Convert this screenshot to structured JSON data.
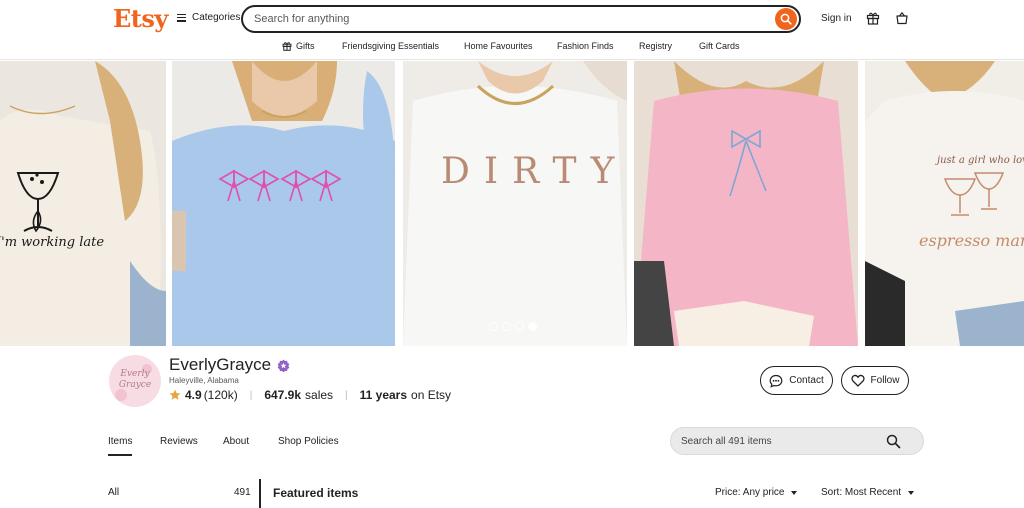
{
  "header": {
    "logo": "Etsy",
    "categories_label": "Categories",
    "search_placeholder": "Search for anything",
    "signin_label": "Sign in"
  },
  "nav": {
    "items": [
      "Gifts",
      "Friendsgiving Essentials",
      "Home Favourites",
      "Fashion Finds",
      "Registry",
      "Gift Cards"
    ]
  },
  "banner": {
    "panels": [
      {
        "text": "I'm working late",
        "shirt_color": "#f2ebe2"
      },
      {
        "text": "",
        "shirt_color": "#a9c8ea"
      },
      {
        "text": "DIRTY",
        "shirt_color": "#f7f7f5"
      },
      {
        "text": "",
        "shirt_color": "#f4b6c6"
      },
      {
        "text": "just a girl who loves",
        "text2": "espresso marti",
        "shirt_color": "#f6f3ef"
      }
    ],
    "slide_count": 4,
    "active_slide": 4
  },
  "shop": {
    "name": "EverlyGrayce",
    "avatar_text": "Everly Grayce",
    "location": "Haleyville, Alabama",
    "rating": "4.9",
    "review_count": "(120k)",
    "sales_value": "647.9k",
    "sales_label": "sales",
    "years_value": "11 years",
    "years_label": "on Etsy",
    "contact_label": "Contact",
    "follow_label": "Follow"
  },
  "tabs": {
    "items": [
      "Items",
      "Reviews",
      "About",
      "Shop Policies"
    ],
    "active": "Items"
  },
  "shop_search": {
    "placeholder": "Search all 491 items"
  },
  "listing": {
    "all_label": "All",
    "all_count": "491",
    "featured_title": "Featured items",
    "price_filter": "Price: Any price",
    "sort_filter": "Sort: Most Recent"
  },
  "colors": {
    "brand": "#f1641e",
    "rating_star": "#e8a33c",
    "star_seller_badge": "#9360c8"
  }
}
